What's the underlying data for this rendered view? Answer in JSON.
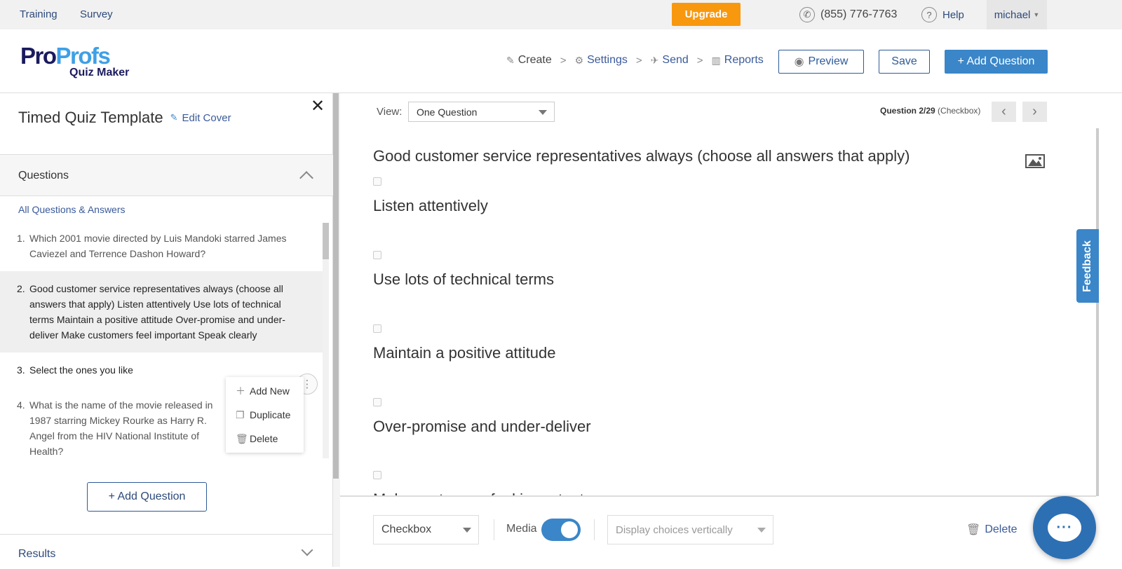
{
  "topbar": {
    "links": [
      "Training",
      "Survey"
    ],
    "upgrade": "Upgrade",
    "phone": "(855) 776-7763",
    "help": "Help",
    "user": "michael"
  },
  "header": {
    "logo_pro": "Pro",
    "logo_profs": "Profs",
    "logo_sub": "Quiz Maker",
    "steps": [
      "Create",
      "Settings",
      "Send",
      "Reports"
    ],
    "preview": "Preview",
    "save": "Save",
    "add_question": "+ Add Question"
  },
  "sidebar": {
    "quiz_title": "Timed Quiz Template",
    "edit_cover": "Edit Cover",
    "questions_heading": "Questions",
    "all_qa": "All Questions & Answers",
    "questions": [
      {
        "num": "1.",
        "text": "Which 2001 movie directed by Luis Mandoki starred James Caviezel and Terrence Dashon Howard?"
      },
      {
        "num": "2.",
        "text": "Good customer service representatives always (choose all answers that apply) Listen attentively Use lots of technical terms Maintain a positive attitude Over-promise and under-deliver Make customers feel important Speak clearly"
      },
      {
        "num": "3.",
        "text": "Select the ones you like"
      },
      {
        "num": "4.",
        "text": "What is the name of the movie released in 1987 starring Mickey Rourke as Harry R. Angel from the HIV National Institute of Health?"
      }
    ],
    "context_menu": [
      "Add New",
      "Duplicate",
      "Delete"
    ],
    "add_question": "+ Add Question",
    "results_heading": "Results"
  },
  "main": {
    "view_label": "View:",
    "view_value": "One Question",
    "counter_bold": "Question 2/29",
    "counter_type": "(Checkbox)",
    "question_title": "Good customer service representatives always (choose all answers that apply)",
    "choices": [
      "Listen attentively",
      "Use lots of technical terms",
      "Maintain a positive attitude",
      "Over-promise and under-deliver",
      "Make customers feel important"
    ],
    "footer": {
      "type_value": "Checkbox",
      "media_label": "Media",
      "media_on": true,
      "display_value": "Display choices vertically",
      "delete": "Delete"
    }
  },
  "feedback": "Feedback"
}
